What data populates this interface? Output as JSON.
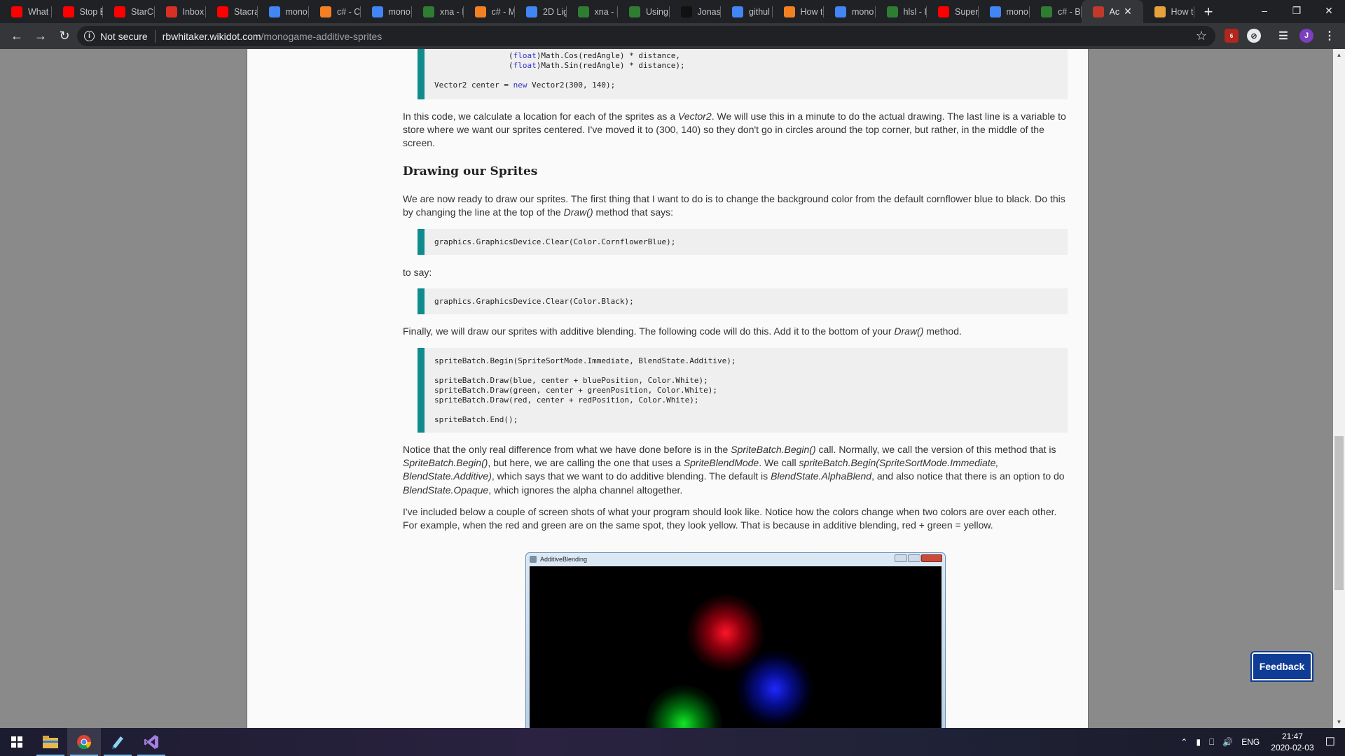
{
  "browser": {
    "tabs": [
      {
        "title": "What",
        "icon": "youtube-icon",
        "color": "#ff0000"
      },
      {
        "title": "Stop E",
        "icon": "youtube-icon",
        "color": "#ff0000"
      },
      {
        "title": "StarCr",
        "icon": "youtube-icon",
        "color": "#ff0000"
      },
      {
        "title": "Inbox",
        "icon": "gmail-icon",
        "color": "#d93025"
      },
      {
        "title": "Stacra",
        "icon": "youtube-icon",
        "color": "#ff0000"
      },
      {
        "title": "mono",
        "icon": "google-icon",
        "color": "#4285f4"
      },
      {
        "title": "c# - C",
        "icon": "stackoverflow-icon",
        "color": "#f48024"
      },
      {
        "title": "mono",
        "icon": "google-icon",
        "color": "#4285f4"
      },
      {
        "title": "xna - I",
        "icon": "gamedev-icon",
        "color": "#2e7d32"
      },
      {
        "title": "c# - M",
        "icon": "stackoverflow-icon",
        "color": "#f48024"
      },
      {
        "title": "2D Lig",
        "icon": "google-icon",
        "color": "#4285f4"
      },
      {
        "title": "xna - I",
        "icon": "gamedev-icon",
        "color": "#2e7d32"
      },
      {
        "title": "Using",
        "icon": "page-icon",
        "color": "#2e7d32"
      },
      {
        "title": "Jonas",
        "icon": "github-icon",
        "color": "#111111"
      },
      {
        "title": "githul",
        "icon": "google-icon",
        "color": "#4285f4"
      },
      {
        "title": "How t",
        "icon": "stackoverflow-icon",
        "color": "#f48024"
      },
      {
        "title": "mono",
        "icon": "google-icon",
        "color": "#4285f4"
      },
      {
        "title": "hlsl - I",
        "icon": "gamedev-icon",
        "color": "#2e7d32"
      },
      {
        "title": "Super",
        "icon": "youtube-icon",
        "color": "#ff0000"
      },
      {
        "title": "mono",
        "icon": "google-icon",
        "color": "#4285f4"
      },
      {
        "title": "c# - B",
        "icon": "gamedev-icon",
        "color": "#2e7d32"
      },
      {
        "title": "Ac",
        "icon": "wikidot-icon",
        "color": "#c0392b",
        "active": true
      },
      {
        "title": "How t",
        "icon": "page-icon",
        "color": "#e6a23c"
      }
    ],
    "new_tab": "+",
    "not_secure_label": "Not secure",
    "url_host": "rbwhitaker.wikidot.com",
    "url_path": "/monogame-additive-sprites",
    "extension_badge": "6",
    "profile_initial": "J"
  },
  "article": {
    "code_top": {
      "line1_kw": "float",
      "line1_rest": "Math.Cos(redAngle) * distance,",
      "line2_kw": "float",
      "line2_rest": "Math.Sin(redAngle) * distance);",
      "line3_pre": "Vector2 center = ",
      "line3_kw": "new",
      "line3_rest": " Vector2(300, 140);"
    },
    "para1_a": "In this code, we calculate a location for each of the sprites as a ",
    "para1_em": "Vector2",
    "para1_b": ". We will use this in a minute to do the actual drawing. The last line is a variable to store where we want our sprites centered. I've moved it to (300, 140) so they don't go in circles around the top corner, but rather, in the middle of the screen.",
    "heading": "Drawing our Sprites",
    "para2_a": "We are now ready to draw our sprites. The first thing that I want to do is to change the background color from the default cornflower blue to black. Do this by changing the line at the top of the ",
    "para2_em": "Draw()",
    "para2_b": " method that says:",
    "code_clear_blue": "graphics.GraphicsDevice.Clear(Color.CornflowerBlue);",
    "to_say": "to say:",
    "code_clear_black": "graphics.GraphicsDevice.Clear(Color.Black);",
    "para3_a": "Finally, we will draw our sprites with additive blending. The following code will do this. Add it to the bottom of your ",
    "para3_em": "Draw()",
    "para3_b": " method.",
    "code_draw": {
      "l1": "spriteBatch.Begin(SpriteSortMode.Immediate, BlendState.Additive);",
      "l2": "spriteBatch.Draw(blue, center + bluePosition, Color.White);",
      "l3": "spriteBatch.Draw(green, center + greenPosition, Color.White);",
      "l4": "spriteBatch.Draw(red, center + redPosition, Color.White);",
      "l5": "spriteBatch.End();"
    },
    "para4": {
      "t1": "Notice that the only real difference from what we have done before is in the ",
      "e1": "SpriteBatch.Begin()",
      "t2": " call. Normally, we call the version of this method that is ",
      "e2": "SpriteBatch.Begin()",
      "t3": ", but here, we are calling the one that uses a ",
      "e3": "SpriteBlendMode",
      "t4": ". We call ",
      "e4": "spriteBatch.Begin(SpriteSortMode.Immediate, BlendState.Additive)",
      "t5": ", which says that we want to do additive blending. The default is ",
      "e5": "BlendState.AlphaBlend",
      "t6": ", and also notice that there is an option to do ",
      "e6": "BlendState.Opaque",
      "t7": ", which ignores the alpha channel altogether."
    },
    "para5": "I've included below a couple of screen shots of what your program should look like. Notice how the colors change when two colors are over each other. For example, when the red and green are on the same spot, they look yellow. That is because in additive blending, red + green = yellow.",
    "game_window_title": "AdditiveBlending"
  },
  "feedback_label": "Feedback",
  "taskbar": {
    "tray_language": "ENG",
    "time": "21:47",
    "date": "2020-02-03"
  },
  "colors": {
    "accent_bar": "#0f8b8d",
    "feedback_bg": "#0f3c95"
  }
}
